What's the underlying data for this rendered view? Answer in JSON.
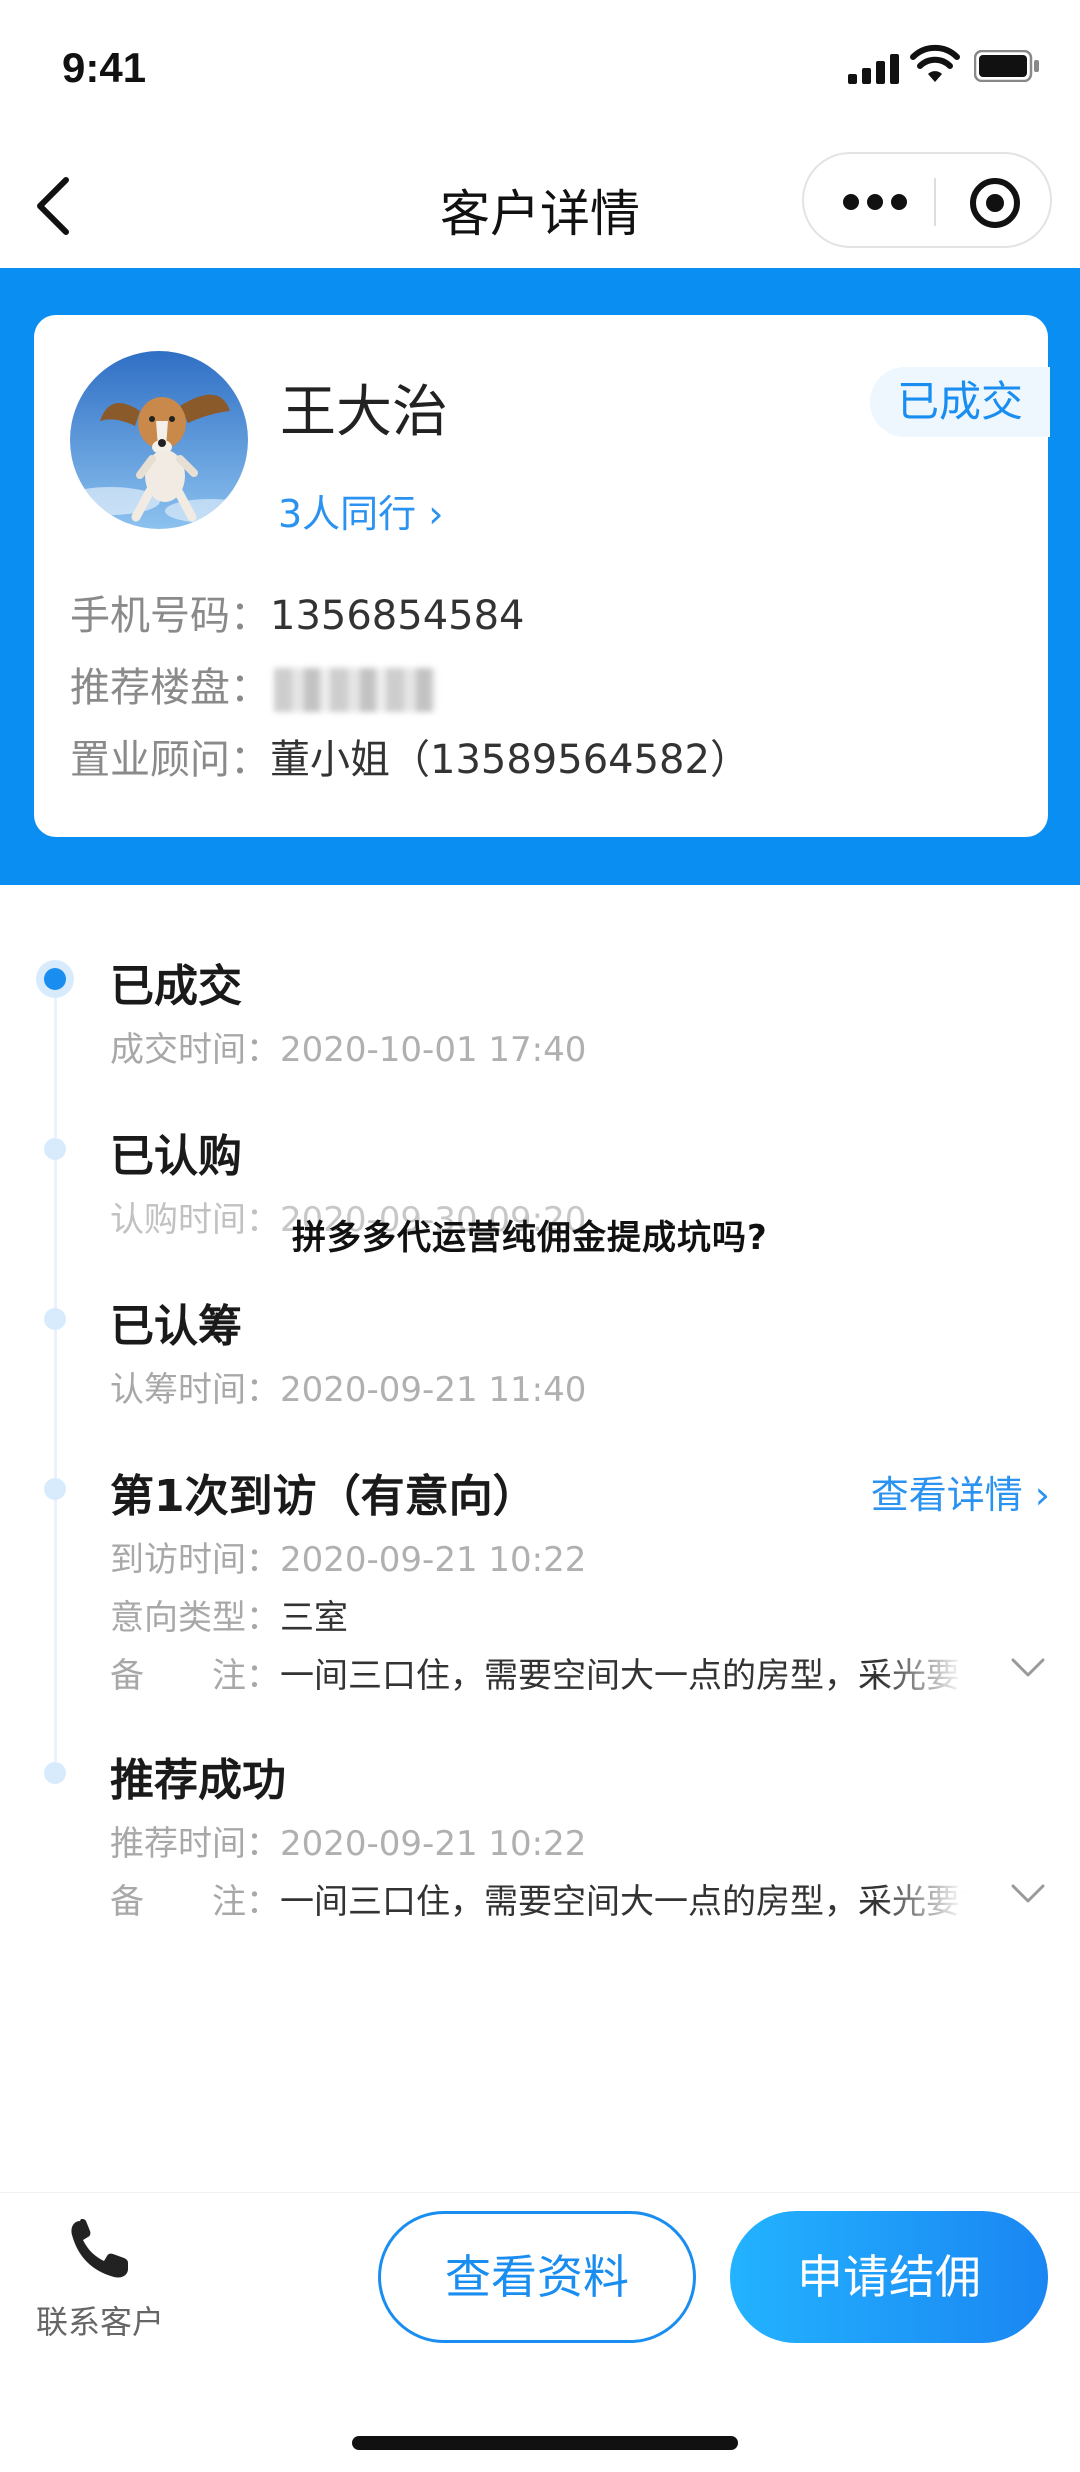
{
  "status_bar": {
    "time": "9:41"
  },
  "nav": {
    "title": "客户详情",
    "back_icon": "back-chevron-icon",
    "more_icon": "more-dots-icon",
    "close_icon": "target-icon"
  },
  "colors": {
    "brand_blue": "#0b8ef2",
    "link_blue": "#2a92f0"
  },
  "customer": {
    "name": "王大治",
    "status": "已成交",
    "companions": "3人同行 ›",
    "phone_label": "手机号码：",
    "phone": "1356854584",
    "property_label": "推荐楼盘：",
    "consultant_label": "置业顾问：",
    "consultant": "董小姐（13589564582）"
  },
  "timeline": {
    "deal": {
      "title": "已成交",
      "label": "成交时间：",
      "value": "2020-10-01  17:40"
    },
    "subscribe": {
      "title": "已认购",
      "label": "认购时间：",
      "value": "2020-09-30  09:20"
    },
    "raise": {
      "title": "已认筹",
      "label": "认筹时间：",
      "value": "2020-09-21  11:40"
    },
    "visit": {
      "title": "第1次到访（有意向）",
      "detail_link": "查看详情 ›",
      "time_label": "到访时间：",
      "time_value": "2020-09-21  10:22",
      "type_label": "意向类型：",
      "type_value": "三室",
      "note_label": "备　　注：",
      "note_value": "一间三口住，需要空间大一点的房型，采光要好"
    },
    "recommend": {
      "title": "推荐成功",
      "time_label": "推荐时间：",
      "time_value": "2020-09-21  10:22",
      "note_label": "备　　注：",
      "note_value": "一间三口住，需要空间大一点的房型，采光要好"
    }
  },
  "overlay": "拼多多代运营纯佣金提成坑吗?",
  "bottom": {
    "contact_label": "联系客户",
    "view_profile": "查看资料",
    "apply_commission": "申请结佣"
  }
}
